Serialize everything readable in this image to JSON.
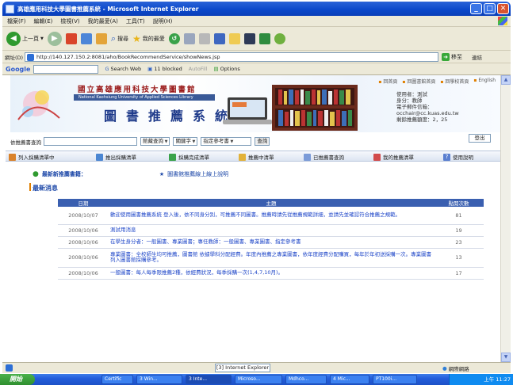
{
  "window": {
    "title": "高雄應用科技大學圖書推薦系統 - Microsoft Internet Explorer",
    "minimize": "_",
    "maximize": "□",
    "close": "✕"
  },
  "menubar": {
    "items": [
      "檔案(F)",
      "編輯(E)",
      "檢視(V)",
      "我的最愛(A)",
      "工具(T)",
      "說明(H)"
    ]
  },
  "toolbar": {
    "back_label": "上一頁",
    "search_label": "搜尋",
    "favorites_label": "我的最愛"
  },
  "addressbar": {
    "label": "網址(D)",
    "url": "http://140.127.150.2:8081/aho/BookRecommendService/showNews.jsp",
    "go_label": "移至",
    "links_label": "連結"
  },
  "googlebar": {
    "brand": "Google",
    "search_web": "Search Web",
    "blocked": "11 blocked",
    "autofill": "AutoFill",
    "options": "Options"
  },
  "banner": {
    "school_name": "國立高雄應用科技大學圖書館",
    "school_en": "National Kaohsiung University of Applied Sciences Library",
    "system_title": "圖書推薦系統",
    "top_links": [
      "回首頁",
      "回圖書館首頁",
      "回學校首頁",
      "English"
    ],
    "user_name_label": "使用者：測試",
    "user_role_label": "身分：教師",
    "user_email_label": "電子郵件信箱：",
    "user_email": "occhair@cc.kuas.edu.tw",
    "user_quota_label": "剩餘推薦額度：2，25",
    "logout_label": "登出"
  },
  "search": {
    "label": "依推薦書查詢",
    "type_value": "館藏查詢",
    "field_value": "關鍵字",
    "scope_value": "指定參考書",
    "submit_label": "查詢"
  },
  "funcbar": {
    "items": [
      "列入採購清單中",
      "推出採購清單",
      "採購完成清單",
      "推薦中清單",
      "已推薦書查詢",
      "我的推薦清單",
      "使用說明"
    ]
  },
  "recommend": {
    "label": "最新新推薦書籍：",
    "link": "圖書館推薦線上線上說明"
  },
  "news": {
    "section_title": "最新消息",
    "headers": {
      "date": "日期",
      "subject": "主題",
      "count": "點閱次數"
    },
    "rows": [
      {
        "date": "2008/10/07",
        "subject": "歡迎使用圖書推薦系統 登入後，依不同身分別，可推薦不同圖書。推薦時請先從推薦規範詳細，並請先並確認符合推薦之規範。",
        "count": "81"
      },
      {
        "date": "2008/10/06",
        "subject": "測試用消息",
        "count": "19"
      },
      {
        "date": "2008/10/06",
        "subject": "在學生身分者：一般圖書、專業圖書；專任教師：一般圖書、專業圖書、指定參考書",
        "count": "23"
      },
      {
        "date": "2008/10/06",
        "subject": "專業圖書：全校師生均可推薦，圖書館 依據學科分配經費。年度內推薦之專業圖書，依年度經費分配購買，每年於年初送採購一次。專業圖書列入圖書館採購參考。",
        "count": "13"
      },
      {
        "date": "2008/10/06",
        "subject": "一般圖書：每人每季限推薦2種，依經費狀況，每季採購一次(1,4,7,10月)。",
        "count": "17"
      }
    ]
  },
  "statusbar": {
    "status_text": "",
    "zone_label": "網際網路",
    "center_label": "[3] Internet Explorer"
  },
  "taskbar": {
    "start_label": "開始",
    "tasks": [
      "Certific",
      "3 Win...",
      "3 Inte...",
      "Microso...",
      "Mdhco...",
      "4 Mic...",
      "PT100i..."
    ],
    "clock": "上午 11:27"
  },
  "colors": {
    "xp_blue": "#0a47c9",
    "table_header": "#3a5fb0",
    "link_blue": "#1e46c8",
    "accent_orange": "#e08000",
    "school_red": "#9a1a1a"
  }
}
